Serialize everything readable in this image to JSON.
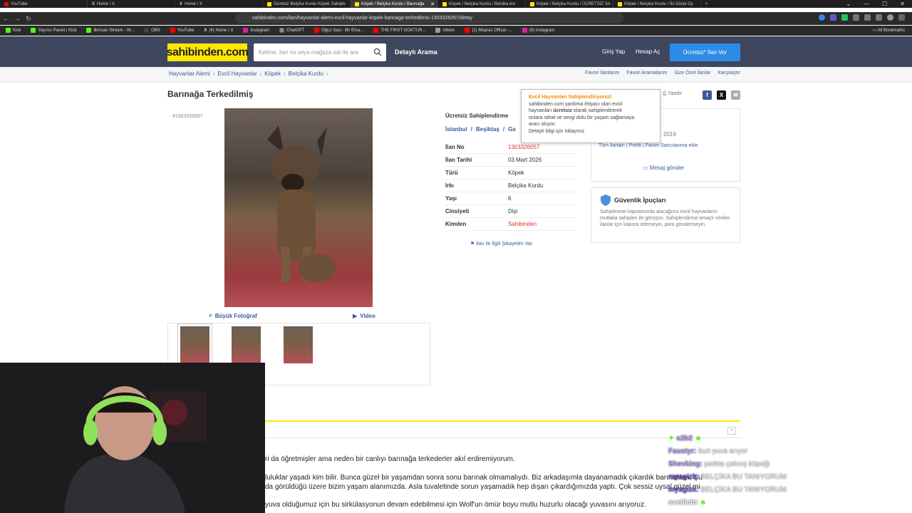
{
  "browser": {
    "tabs": [
      {
        "label": "YouTube",
        "color": "#ff0000"
      },
      {
        "label": "Home / X",
        "color": "#ffffff"
      },
      {
        "label": "Home / X",
        "color": "#ffffff"
      },
      {
        "label": "Ücretsiz Belçika Kurdu Köpek Sahiple",
        "color": "#ffe800"
      },
      {
        "label": "Köpek / Belçika Kurdu / Barınağa",
        "color": "#ffe800"
      },
      {
        "label": "Köpek / Belçika Kurdu / Belcika kur",
        "color": "#ffe800"
      },
      {
        "label": "Köpek / Belçika Kurdu / ÜCRETSİZ SA",
        "color": "#ffe800"
      },
      {
        "label": "Köpek / Belçika Kurdu / İki Güzel Oy",
        "color": "#ffe800"
      }
    ],
    "url": "sahibinden.com/ilan/hayvanlar-alemi-evcil-hayvanlar-kopek-barinaga-terkedilmis-1303326057/detay",
    "bookmarks": [
      {
        "label": "Kick",
        "color": "#53fc18"
      },
      {
        "label": "Yayıncı Paneli | Kick",
        "color": "#53fc18"
      },
      {
        "label": "ilkinsan Stream - W...",
        "color": "#53fc18"
      },
      {
        "label": "OBS",
        "color": "#444444"
      },
      {
        "label": "YouTube",
        "color": "#ff0000"
      },
      {
        "label": "(4) Home / X",
        "color": "#ffffff"
      },
      {
        "label": "Instagram",
        "color": "#d6249f"
      },
      {
        "label": "ChatGPT",
        "color": "#888888"
      },
      {
        "label": "Oğuz Sasi - Bir Efsa...",
        "color": "#ff0000"
      },
      {
        "label": "THE FIRST GOKTUR...",
        "color": "#ff0000"
      },
      {
        "label": "Albüm",
        "color": "#999999"
      },
      {
        "label": "(1) Mepraz Offical -...",
        "color": "#ff0000"
      },
      {
        "label": "(9) Instagram",
        "color": "#d6249f"
      }
    ],
    "all_bookmarks": "All Bookmarks"
  },
  "header": {
    "logo": "sahibinden.com",
    "search_placeholder": "Kelime, ilan no veya mağaza adı ile ara",
    "detailed_search": "Detaylı Arama",
    "login": "Giriş Yap",
    "register": "Hesap Aç",
    "post_ad": "Ücretsiz* İlan Ver"
  },
  "breadcrumb": [
    "Hayvanlar Alemi",
    "Evcil Hayvanlar",
    "Köpek",
    "Belçika Kurdu"
  ],
  "toplinks": [
    "Favori İlanlarım",
    "Favori Aramalarım",
    "Size Özel İlanlar",
    "Karşılaştır"
  ],
  "listing": {
    "title": "Barınağa Terkedilmiş",
    "id_label": "#1303326057",
    "photo_tools": {
      "big_photo": "Büyük Fotoğraf",
      "video": "Video"
    },
    "category": "Ücretsiz Sahiplendirme",
    "location": [
      "İstanbul",
      "/",
      "Beşiktaş",
      "/",
      "Ga"
    ],
    "details": [
      {
        "key": "İlan No",
        "value": "1303326057",
        "red": true
      },
      {
        "key": "İlan Tarihi",
        "value": "03 Mart 2026",
        "red": false
      },
      {
        "key": "Türü",
        "value": "Köpek",
        "red": false
      },
      {
        "key": "Irkı",
        "value": "Belçika Kurdu",
        "red": false
      },
      {
        "key": "Yaşı",
        "value": "6",
        "red": false
      },
      {
        "key": "Cinsiyeti",
        "value": "Dişi",
        "red": false
      },
      {
        "key": "Kimden",
        "value": "Sahibinden",
        "red": true
      }
    ],
    "complaint": "İlan ile İlgili Şikayetim Var"
  },
  "right": {
    "print": "Yazdır",
    "seller_year": "2019",
    "seller_links": "Tüm İlanları  |  Profili  |  Favori Satıcılarıma ekle",
    "send_message": "Mesaj gönder",
    "security_title": "Güvenlik İpuçları",
    "security_text": "Sahiplenme kapsamında alacağınız evcil hayvanların mutlaka sahipleri ile görüşün. Sahiplendirme amaçlı verilen ilanlar için kapora ödemeyin, para göndermeyin."
  },
  "tooltip": {
    "title": "Evcil Hayvanları Sahiplendiriyoruz!",
    "line1": "sahibinden.com yardıma ihtiyacı olan evcil",
    "line2a": "hayvanları ",
    "line2b": "ücretsiz",
    "line2c": " olarak sahiplendirerek",
    "line3": "onlara rahat ve sevgi dolu bir yaşam sağlamaya",
    "line4": "aracı oluyor.",
    "line5": "Detaylı bilgi için tıklayınız"
  },
  "description": [
    "ri da öğretmişler ama neden bir canlıyı barınağa terkederler akıl erdiremiyorum.",
    "luluklar yaşadı kim bilir. Bunca güzel bir yaşamdan sonra sonu barınak olmamalıydı. Biz arkadaşımla dayanamadık çıkardık barınaktan. Şu",
    "da görüldüğü üzere bizim yaşam alanımızda. Asla tuvaletinde sorun yaşamadık hep dışarı çıkardığımızda yaptı. Çok sessiz uysal güzel mi",
    "yuva olduğumuz için bu sirkülasyonun devam edebilmesi için Wolf'un ömür boyu mutlu huzurlu olacağı yuvasını arıyoruz."
  ],
  "chat": [
    {
      "user": "s2b2",
      "text": ""
    },
    {
      "user": "Faustyr:",
      "text": "kurt yuva arıyor"
    },
    {
      "user": "Shevking:",
      "text": "parkta çalınış köpeği"
    },
    {
      "user": "myagizk:",
      "text": "BELÇİKA BU TANIYORUM"
    },
    {
      "user": "myagizk:",
      "text": "BELÇİKA BU TANIYORUM"
    },
    {
      "user": "svetlicht",
      "text": ""
    }
  ],
  "colors": {
    "brand_yellow": "#ffe800",
    "header_bg": "#3f475f",
    "link": "#395b9f",
    "red": "#e0322d",
    "button_blue": "#2e8ce6"
  }
}
